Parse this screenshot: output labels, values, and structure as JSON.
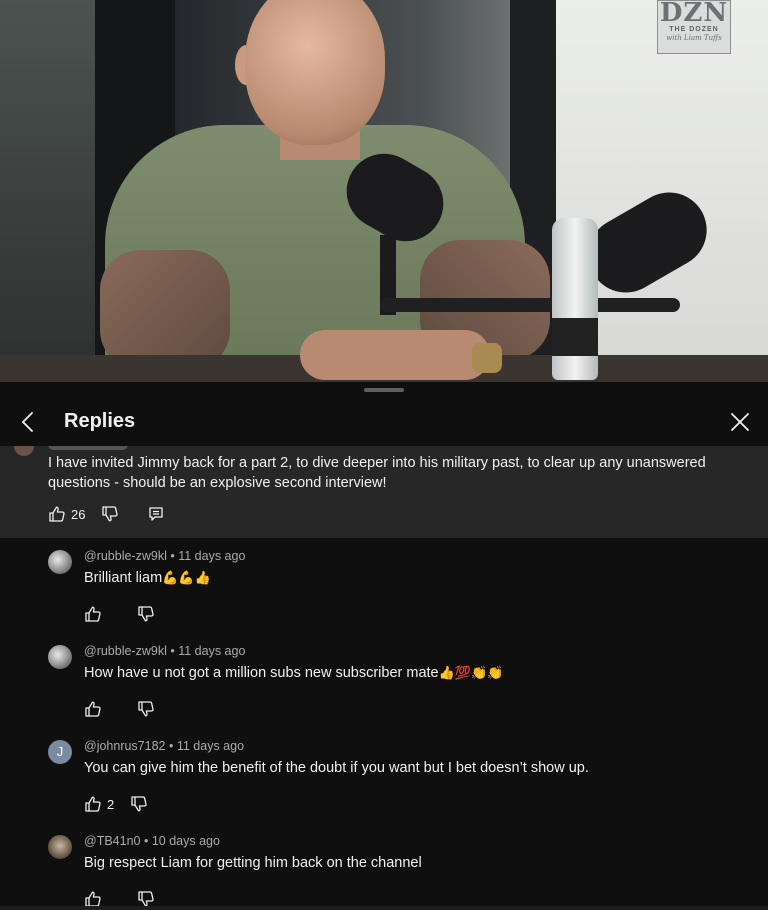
{
  "video": {
    "logo_main": "DZN",
    "logo_sub": "THE DOZEN",
    "logo_sig": "with Liam Tuffs"
  },
  "panel": {
    "title": "Replies"
  },
  "parent_comment": {
    "text": "I have invited Jimmy back for a part 2, to dive deeper into his military past, to clear up any unanswered questions - should be an explosive second interview!",
    "likes": "26"
  },
  "replies": [
    {
      "author": "@rubble-zw9kl",
      "time": "11 days ago",
      "text": "Brilliant  liam",
      "emoji": "💪💪👍",
      "likes": ""
    },
    {
      "author": "@rubble-zw9kl",
      "time": "11 days ago",
      "text": "How have u not got a million subs new subscriber mate",
      "emoji": "👍💯👏👏",
      "likes": ""
    },
    {
      "author": "@johnrus7182",
      "time": "11 days ago",
      "text": "You can give him the benefit of the doubt if you want but I bet doesn’t show up.",
      "avatar_letter": "J",
      "likes": "2"
    },
    {
      "author": "@TB41n0",
      "time": "10 days ago",
      "text": "Big respect Liam for getting him back on the channel",
      "likes": ""
    }
  ],
  "meta_separator": "•",
  "icons": [
    "back-icon",
    "close-icon",
    "thumbs-up-icon",
    "thumbs-down-icon",
    "reply-icon"
  ]
}
